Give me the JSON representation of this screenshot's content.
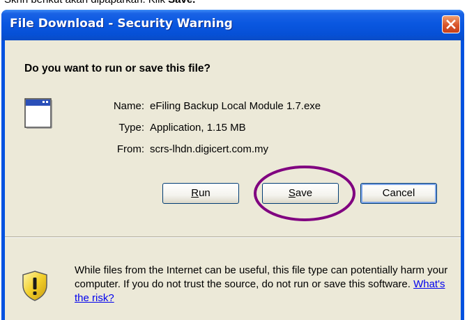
{
  "caption": {
    "text": "Skrin berikut akan dipaparkan. Klik ",
    "emphasis": "Save."
  },
  "dialog": {
    "title": "File Download - Security Warning",
    "question": "Do you want to run or save this file?",
    "details": {
      "name_label": "Name:",
      "name_value": "eFiling Backup Local Module 1.7.exe",
      "type_label": "Type:",
      "type_value": "Application, 1.15 MB",
      "from_label": "From:",
      "from_value": "scrs-lhdn.digicert.com.my"
    },
    "buttons": {
      "run_access": "R",
      "run_rest": "un",
      "save_access": "S",
      "save_rest": "ave",
      "cancel": "Cancel"
    },
    "warning": {
      "text": "While files from the Internet can be useful, this file type can potentially harm your computer. If you do not trust the source, do not run or save this software. ",
      "link": "What's the risk?"
    }
  },
  "colors": {
    "title_bar": "#0a57e0",
    "client_bg": "#ece9d8",
    "highlight_ellipse": "#800080",
    "link": "#0000ee"
  },
  "icons": {
    "close": "close-icon",
    "app": "application-window-icon",
    "warning": "security-shield-warning-icon"
  }
}
